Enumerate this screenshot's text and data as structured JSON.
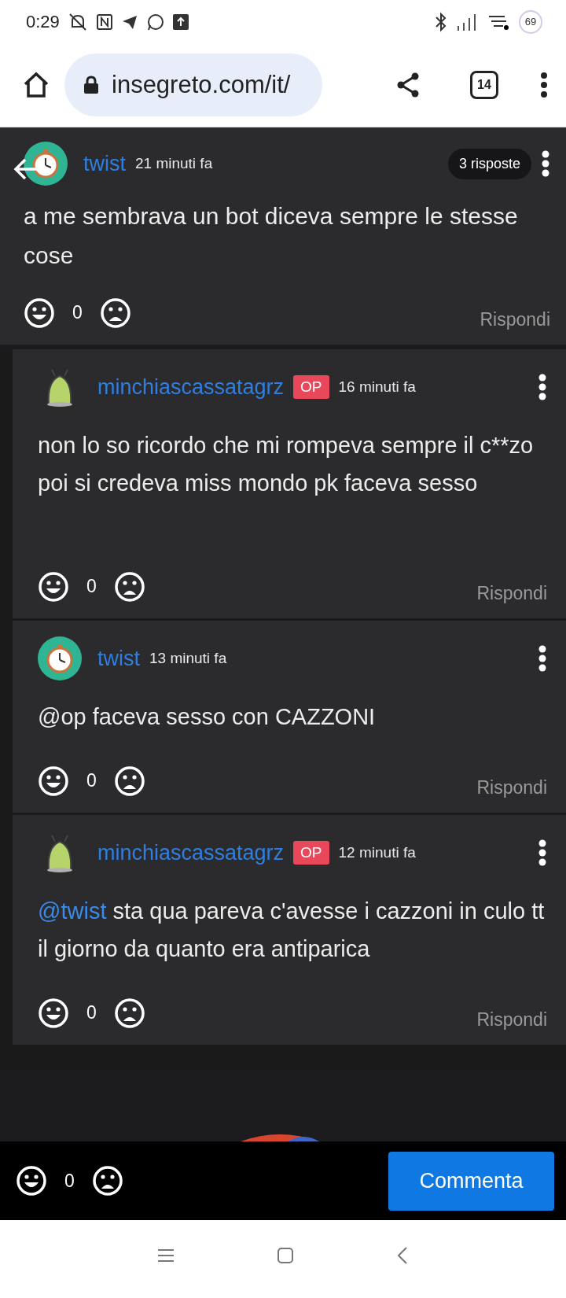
{
  "status_bar": {
    "time": "0:29",
    "battery": "69"
  },
  "browser": {
    "url": "insegreto.com/it/",
    "tab_count": "14"
  },
  "comment": {
    "author": "twist",
    "avatar": {
      "kind": "clock"
    },
    "time": "21 minuti fa",
    "replies": "3 risposte",
    "text": "a me sembrava un bot diceva sempre le stesse cose",
    "score": "0",
    "reply_label": "Rispondi"
  },
  "replies": [
    {
      "author": "minchiascassatagrz",
      "avatar": {
        "kind": "alien"
      },
      "badge": "OP",
      "time": "16 minuti fa",
      "text": "non lo so ricordo che mi rompeva sempre il c**zo poi si credeva miss mondo pk faceva sesso",
      "score": "0",
      "reply_label": "Rispondi"
    },
    {
      "author": "twist",
      "avatar": {
        "kind": "clock"
      },
      "time": "13 minuti fa",
      "text": "@op faceva sesso con CAZZONI",
      "score": "0",
      "reply_label": "Rispondi"
    },
    {
      "author": "minchiascassatagrz",
      "avatar": {
        "kind": "alien"
      },
      "badge": "OP",
      "time": "12 minuti fa",
      "mention": "@twist",
      "text": " sta qua pareva c'avesse i cazzoni in culo tt il giorno da quanto era antiparica",
      "score": "0",
      "reply_label": "Rispondi"
    }
  ],
  "footer": {
    "score": "0",
    "button": "Commenta"
  }
}
